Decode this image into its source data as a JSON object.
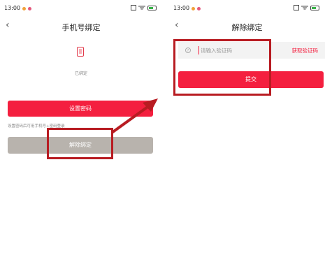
{
  "left": {
    "status": {
      "time": "13:00"
    },
    "nav": {
      "back": "‹",
      "title": "手机号绑定"
    },
    "bound_label": "已绑定",
    "set_password_button": "设置密码",
    "hint": "设置密码后可用手机号+密码登录",
    "unbind_button": "解除绑定"
  },
  "right": {
    "status": {
      "time": "13:00"
    },
    "nav": {
      "back": "‹",
      "title": "解除绑定"
    },
    "code_input": {
      "value": "",
      "placeholder": "请输入验证码"
    },
    "help_icon": "?",
    "get_code_link": "获取验证码",
    "submit_button": "提交"
  },
  "colors": {
    "primary_red": "#f41f3f",
    "disabled_gray": "#b8b3ad",
    "highlight_red": "#b81c22"
  },
  "icons": [
    "back-chevron-icon",
    "phone-icon",
    "help-icon",
    "signal-icon",
    "wifi-icon",
    "battery-icon"
  ]
}
